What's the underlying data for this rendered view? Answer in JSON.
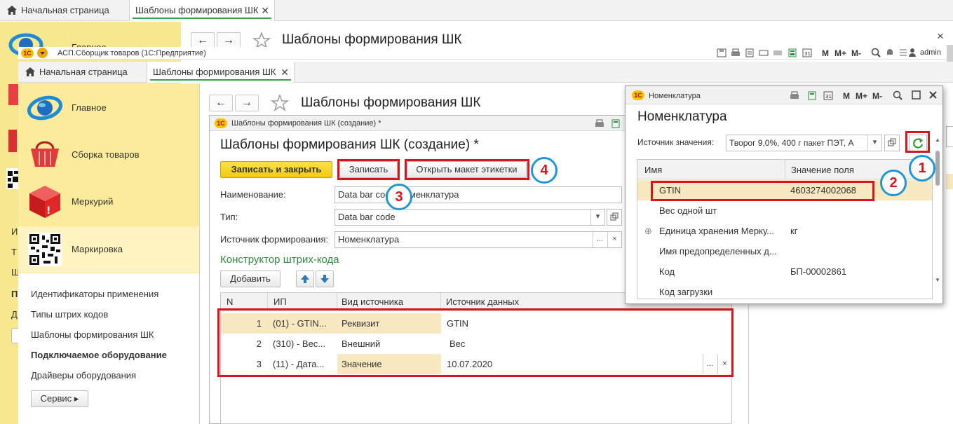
{
  "bg": {
    "tabs": {
      "home": "Начальная страница",
      "active": "Шаблоны формирования ШК",
      "close": "✕"
    },
    "title": "Шаблоны формирования ШК",
    "side_main": "Главное",
    "side_letters": [
      "И",
      "Т",
      "Ш",
      "П",
      "Д"
    ],
    "close": "×"
  },
  "app": {
    "title": "АСП.Сборщик товаров  (1С:Предприятие)",
    "user": "admin",
    "toolbar": {
      "m": "M",
      "mplus": "M+",
      "mminus": "M-"
    }
  },
  "tabs": {
    "home": "Начальная страница",
    "active": "Шаблоны формирования ШК",
    "close": "✕"
  },
  "sidebar": {
    "items": [
      "Главное",
      "Сборка товаров",
      "Меркурий",
      "Маркировка"
    ],
    "links": [
      "Идентификаторы применения",
      "Типы штрих кодов",
      "Шаблоны формирования ШК",
      "Подключаемое оборудование",
      "Драйверы оборудования"
    ],
    "service": "Сервис ▸"
  },
  "page": {
    "title": "Шаблоны формирования ШК"
  },
  "form": {
    "win_title": "Шаблоны формирования ШК (создание) *",
    "title": "Шаблоны формирования ШК (создание) *",
    "buttons": {
      "save_close": "Записать и закрыть",
      "save": "Записать",
      "open_label": "Открыть макет этикетки"
    },
    "fields": {
      "name_label": "Наименование:",
      "name_value": "Data bar code Номенклатура",
      "type_label": "Тип:",
      "type_value": "Data bar code",
      "source_label": "Источник формирования:",
      "source_value": "Номенклатура"
    },
    "constructor": {
      "title": "Конструктор штрих-кода",
      "add": "Добавить"
    },
    "table": {
      "headers": [
        "N",
        "ИП",
        "Вид источника",
        "Источник данных"
      ],
      "rows": [
        {
          "n": "1",
          "ip": "(01) - GTIN...",
          "kind": "Реквизит",
          "source": "GTIN"
        },
        {
          "n": "2",
          "ip": "(310) - Вес...",
          "kind": "Внешний",
          "source": "Вес"
        },
        {
          "n": "3",
          "ip": "(11) - Дата...",
          "kind": "Значение",
          "source": "10.07.2020"
        }
      ]
    }
  },
  "popup": {
    "win_title": "Номенклатура",
    "title": "Номенклатура",
    "source_label": "Источник значения:",
    "source_value": "Творог 9,0%, 400 г пакет ПЭТ, А",
    "headers": [
      "Имя",
      "Значение поля"
    ],
    "rows": [
      {
        "name": "GTIN",
        "value": "4603274002068"
      },
      {
        "name": "Вес одной шт",
        "value": ""
      },
      {
        "name": "Единица хранения Мерку...",
        "value": "кг"
      },
      {
        "name": "Имя предопределенных д...",
        "value": ""
      },
      {
        "name": "Код",
        "value": "БП-00002861"
      },
      {
        "name": "Код загрузки",
        "value": ""
      }
    ]
  },
  "markers": [
    "1",
    "2",
    "3",
    "4"
  ],
  "colors": {
    "accent_red": "#d9141b",
    "marker_blue": "#2096d6",
    "sidebar": "#fbeb9a",
    "save_close": "#f6d31b"
  }
}
